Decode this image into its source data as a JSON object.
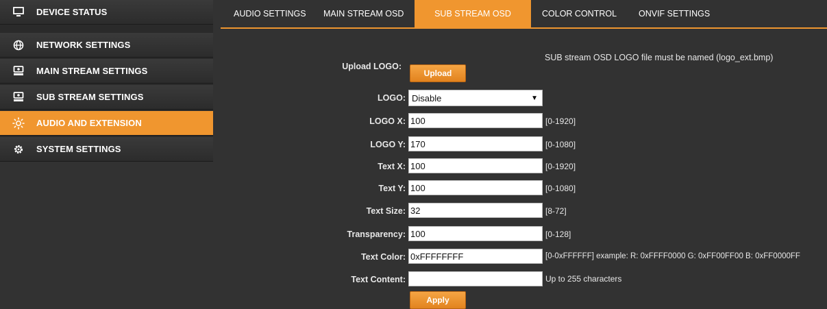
{
  "sidebar": {
    "items": [
      {
        "label": "DEVICE STATUS",
        "icon": "monitor-icon"
      },
      {
        "label": "NETWORK SETTINGS",
        "icon": "globe-icon"
      },
      {
        "label": "MAIN STREAM SETTINGS",
        "icon": "camera-icon"
      },
      {
        "label": "SUB STREAM SETTINGS",
        "icon": "camera-icon"
      },
      {
        "label": "AUDIO AND EXTENSION",
        "icon": "sun-icon",
        "active": true
      },
      {
        "label": "SYSTEM SETTINGS",
        "icon": "gear-icon"
      }
    ]
  },
  "tabs": [
    {
      "label": "AUDIO SETTINGS"
    },
    {
      "label": "MAIN STREAM OSD"
    },
    {
      "label": "SUB STREAM OSD",
      "active": true
    },
    {
      "label": "COLOR CONTROL"
    },
    {
      "label": "ONVIF SETTINGS"
    }
  ],
  "form": {
    "logo_note": "SUB stream OSD LOGO file must be named (logo_ext.bmp)",
    "upload_label": "Upload LOGO:",
    "upload_button": "Upload",
    "logo_label": "LOGO:",
    "logo_value": "Disable",
    "logo_x": {
      "label": "LOGO X:",
      "value": "100",
      "hint": "[0-1920]"
    },
    "logo_y": {
      "label": "LOGO Y:",
      "value": "170",
      "hint": "[0-1080]"
    },
    "text_x": {
      "label": "Text X:",
      "value": "100",
      "hint": "[0-1920]"
    },
    "text_y": {
      "label": "Text Y:",
      "value": "100",
      "hint": "[0-1080]"
    },
    "text_size": {
      "label": "Text Size:",
      "value": "32",
      "hint": "[8-72]"
    },
    "transparency": {
      "label": "Transparency:",
      "value": "100",
      "hint": "[0-128]"
    },
    "text_color": {
      "label": "Text Color:",
      "value": "0xFFFFFFFF",
      "hint": "[0-0xFFFFFF] example: R: 0xFFFF0000 G: 0xFF00FF00 B: 0xFF0000FF"
    },
    "text_content": {
      "label": "Text Content:",
      "value": "",
      "hint": "Up to 255 characters"
    },
    "apply_button": "Apply"
  },
  "colors": {
    "accent": "#f0962f",
    "background": "#323232",
    "sidebar": "#2c2c2c"
  }
}
